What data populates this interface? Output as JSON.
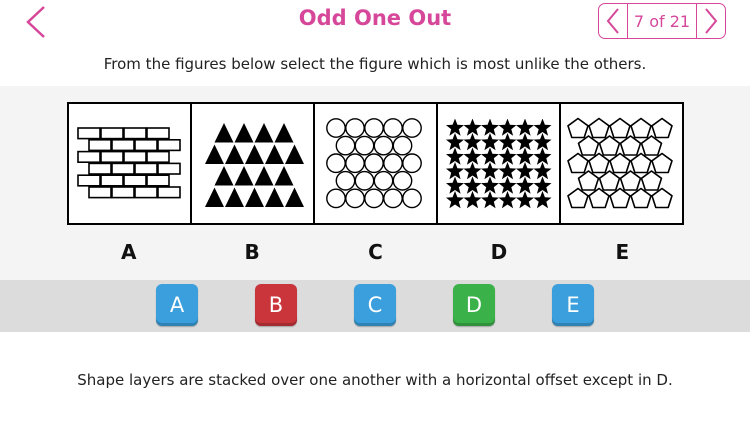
{
  "header": {
    "title": "Odd One Out",
    "back_icon": "chevron-left-icon",
    "pager": {
      "label": "7 of 21",
      "prev_icon": "chevron-left-icon",
      "next_icon": "chevron-right-icon"
    }
  },
  "instruction": "From the figures below select the figure which is most unlike the others.",
  "figures": [
    {
      "letter": "A",
      "pattern": "bricks"
    },
    {
      "letter": "B",
      "pattern": "triangles"
    },
    {
      "letter": "C",
      "pattern": "circles"
    },
    {
      "letter": "D",
      "pattern": "stars"
    },
    {
      "letter": "E",
      "pattern": "pentagons"
    }
  ],
  "answers": [
    {
      "label": "A",
      "color": "#3a9fdc"
    },
    {
      "label": "B",
      "color": "#c9353b"
    },
    {
      "label": "C",
      "color": "#3a9fdc"
    },
    {
      "label": "D",
      "color": "#3bb14a"
    },
    {
      "label": "E",
      "color": "#3a9fdc"
    }
  ],
  "explanation": "Shape layers are stacked over one another with a horizontal offset except in D.",
  "colors": {
    "accent": "#d6479a"
  }
}
